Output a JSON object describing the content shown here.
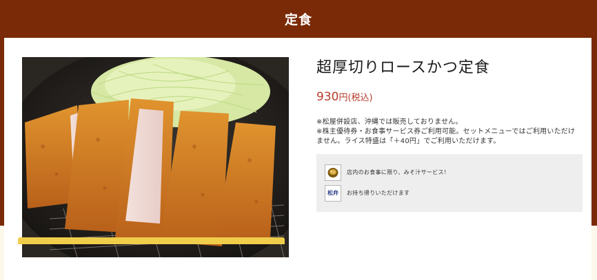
{
  "page": {
    "title": "定食"
  },
  "product": {
    "name": "超厚切りロースかつ定食",
    "price": "930",
    "yen": "円",
    "tax_note": "(税込)",
    "image": "tonkatsu-photo"
  },
  "notes": [
    "※松屋併設店、沖縄では販売しておりません。",
    "※株主優待券・お食事サービス券ご利用可能。セットメニューではご利用いただけません。ライス特盛は「＋40円」でご利用いただけます。"
  ],
  "services": [
    {
      "icon": "miso-soup-icon",
      "text": "店内のお食事に限り、みそ汁サービス！"
    },
    {
      "icon": "takeout-icon",
      "icon_text": "松弁",
      "text": "お持ち帰りいただけます"
    }
  ],
  "colors": {
    "header_bg": "#7a2a06",
    "price": "#b53b2a",
    "accent_yellow": "#f0cd4b"
  }
}
